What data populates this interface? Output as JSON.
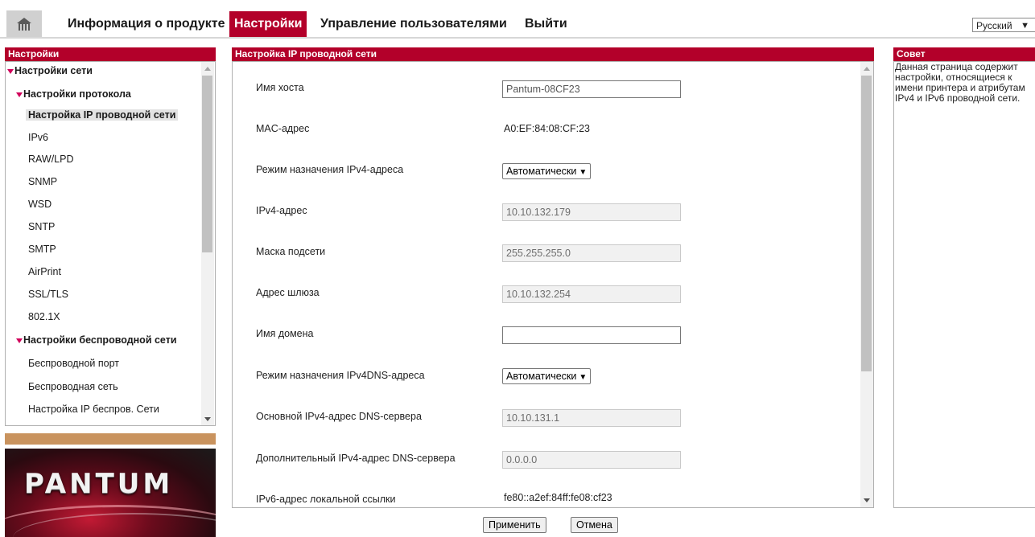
{
  "nav": {
    "items": [
      "Информация о продукте",
      "Настройки",
      "Управление пользователями",
      "Выйти"
    ],
    "active_index": 1,
    "language": "Русский"
  },
  "left_panel": {
    "title": "Настройки",
    "tree": [
      {
        "label": "Настройки сети",
        "level": 0,
        "expanded": true,
        "bold": true
      },
      {
        "label": "Настройки протокола",
        "level": 1,
        "expanded": true,
        "bold": true
      },
      {
        "label": "Настройка IP проводной сети",
        "level": 2,
        "selected": true
      },
      {
        "label": "IPv6",
        "level": 2
      },
      {
        "label": "RAW/LPD",
        "level": 2
      },
      {
        "label": "SNMP",
        "level": 2
      },
      {
        "label": "WSD",
        "level": 2
      },
      {
        "label": "SNTP",
        "level": 2
      },
      {
        "label": "SMTP",
        "level": 2
      },
      {
        "label": "AirPrint",
        "level": 2
      },
      {
        "label": "SSL/TLS",
        "level": 2
      },
      {
        "label": "802.1X",
        "level": 2
      },
      {
        "label": "Настройки беспроводной сети",
        "level": 1,
        "expanded": true,
        "bold": true
      },
      {
        "label": "Беспроводной порт",
        "level": 2
      },
      {
        "label": "Беспроводная сеть",
        "level": 2
      },
      {
        "label": "Настройка IP беспров. Сети",
        "level": 2
      }
    ]
  },
  "main_panel": {
    "title": "Настройка IP проводной сети",
    "fields": [
      {
        "label": "Имя хоста",
        "type": "input",
        "value": "Pantum-08CF23",
        "disabled": false
      },
      {
        "label": "MAC-адрес",
        "type": "text",
        "value": "A0:EF:84:08:CF:23"
      },
      {
        "label": "Режим назначения IPv4-адреса",
        "type": "select",
        "value": "Автоматически"
      },
      {
        "label": "IPv4-адрес",
        "type": "input",
        "value": "10.10.132.179",
        "disabled": true
      },
      {
        "label": "Маска подсети",
        "type": "input",
        "value": "255.255.255.0",
        "disabled": true
      },
      {
        "label": "Адрес шлюза",
        "type": "input",
        "value": "10.10.132.254",
        "disabled": true
      },
      {
        "label": "Имя домена",
        "type": "input",
        "value": "",
        "disabled": false
      },
      {
        "label": "Режим назначения IPv4DNS-адреса",
        "type": "select",
        "value": "Автоматически"
      },
      {
        "label": "Основной IPv4-адрес DNS-сервера",
        "type": "input",
        "value": "10.10.131.1",
        "disabled": true
      },
      {
        "label": "Дополнительный IPv4-адрес DNS-сервера",
        "type": "input",
        "value": "0.0.0.0",
        "disabled": true
      },
      {
        "label": "IPv6-адрес локальной ссылки",
        "type": "text",
        "value": "fe80::a2ef:84ff:fe08:cf23"
      }
    ],
    "apply_label": "Применить",
    "cancel_label": "Отмена"
  },
  "tip_panel": {
    "title": "Совет",
    "text": "Данная страница содержит настройки, относящиеся к имени принтера и атрибутам IPv4 и IPv6 проводной сети."
  },
  "logo": {
    "text": "PANTUM"
  },
  "colors": {
    "accent": "#b3002a",
    "tree_arrow": "#d1005a",
    "logo_bar": "#c9935e"
  }
}
